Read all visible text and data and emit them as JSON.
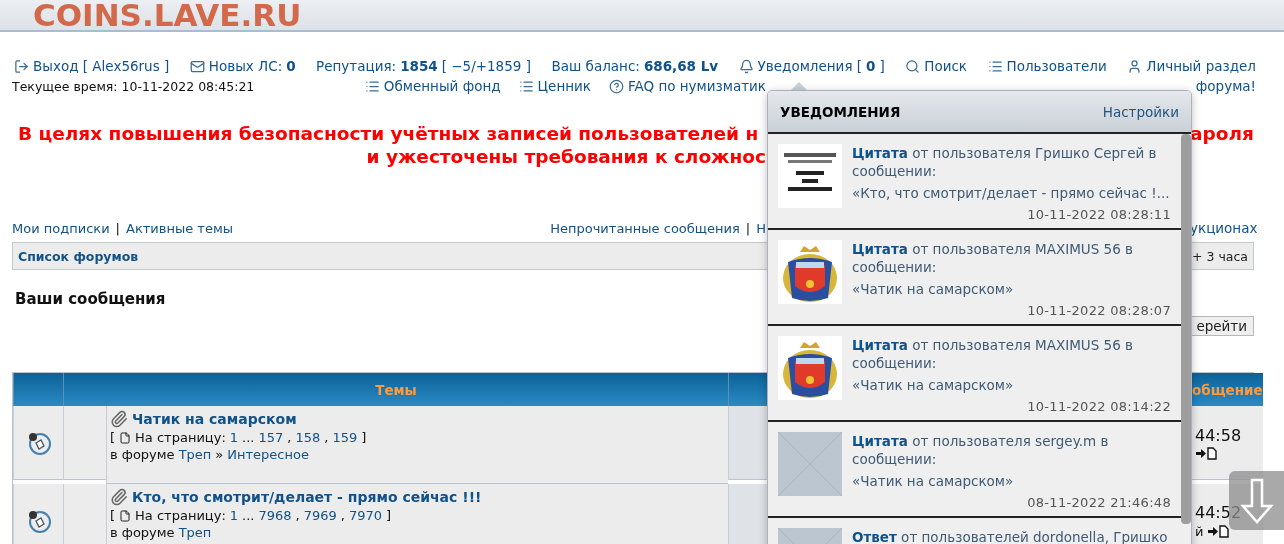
{
  "site_logo": "COINS.LAVE.RU",
  "user_bar": [
    {
      "text": "Выход [ Alex56rus ]"
    },
    {
      "text": "Новых ЛС: **0**"
    },
    {
      "text": "Репутация: **1854** [ −5/+1859 ]"
    },
    {
      "text": "Ваш баланс: **686,68 Lv**"
    },
    {
      "text": "Уведомления [**0**]"
    },
    {
      "text": "Поиск"
    },
    {
      "text": "Пользователи"
    },
    {
      "text": "Личный раздел"
    }
  ],
  "current_time": "Текущее время: 10-11-2022 08:45:21",
  "quick_links": [
    {
      "text": "Обменный фонд"
    },
    {
      "text": "Ценник"
    },
    {
      "text": "FAQ по нумизматик"
    }
  ],
  "quick_links_right": "форума!",
  "notice": {
    "line1_left": "В целях повышения безопасности учётных записей пользователей н",
    "line1_right": "ароля",
    "line2_left": "и ужесточены требования к сложнос"
  },
  "left_links": [
    {
      "text": "Мои подписки",
      "kind": "link"
    },
    {
      "text": "|",
      "kind": "sep"
    },
    {
      "text": "Активные темы",
      "kind": "link"
    }
  ],
  "middle_links": [
    {
      "text": "Непрочитанные сообщения",
      "kind": "link"
    },
    {
      "text": "|",
      "kind": "sep"
    },
    {
      "text": "Н",
      "kind": "link"
    }
  ],
  "right_link": "укционах",
  "nav_bar": {
    "title": "Список форумов",
    "timezone": "+ 3 часа"
  },
  "page_title": "Ваши сообщения",
  "go_button": "ерейти",
  "table": {
    "columns": [
      {
        "label": "Темы"
      },
      {
        "label": "общение"
      }
    ],
    "rows": [
      {
        "title": "Чатик на самарском",
        "pages_open": "[",
        "pages_label": "На страницу:",
        "pages": [
          {
            "text": "1",
            "kind": "link"
          },
          {
            "text": "...",
            "kind": "text"
          },
          {
            "text": "157",
            "kind": "link"
          },
          {
            "text": ",",
            "kind": "text"
          },
          {
            "text": "158",
            "kind": "link"
          },
          {
            "text": ",",
            "kind": "text"
          },
          {
            "text": "159",
            "kind": "link"
          }
        ],
        "pages_close": "]",
        "forum_label": "в форуме",
        "forum_path": [
          {
            "text": "Треп",
            "kind": "link"
          },
          {
            "text": "»",
            "kind": "text"
          },
          {
            "text": "Интересное",
            "kind": "link"
          }
        ],
        "last_time": "44:58"
      },
      {
        "title": "Кто, что смотрит/делает - прямо сейчас !!!",
        "pages_open": "[",
        "pages_label": "На страницу:",
        "pages": [
          {
            "text": "1",
            "kind": "link"
          },
          {
            "text": "...",
            "kind": "text"
          },
          {
            "text": "7968",
            "kind": "link"
          },
          {
            "text": ",",
            "kind": "text"
          },
          {
            "text": "7969",
            "kind": "link"
          },
          {
            "text": ",",
            "kind": "text"
          },
          {
            "text": "7970",
            "kind": "link"
          }
        ],
        "pages_close": "]",
        "forum_label": "в форуме",
        "forum_path": [
          {
            "text": "Треп",
            "kind": "link"
          }
        ],
        "last_time": "44:52",
        "last_author": "й"
      }
    ]
  },
  "notifications": {
    "title": "УВЕДОМЛЕНИЯ",
    "settings": "Настройки",
    "items": [
      {
        "kind": "logo",
        "text": "**Цитата** от пользователя Гришко Сергей в сообщении:",
        "quote": "«Кто, что смотрит/делает - прямо сейчас !...",
        "time": "10-11-2022 08:28:11"
      },
      {
        "kind": "crest",
        "text": "**Цитата** от пользователя MAXIMUS 56 в сообщении:",
        "quote": "«Чатик на самарском»",
        "time": "10-11-2022 08:28:07"
      },
      {
        "kind": "crest",
        "text": "**Цитата** от пользователя MAXIMUS 56 в сообщении:",
        "quote": "«Чатик на самарском»",
        "time": "10-11-2022 08:14:22"
      },
      {
        "kind": "blank",
        "text": "**Цитата** от пользователя sergey.m в сообщении:",
        "quote": "«Чатик на самарском»",
        "time": "08-11-2022 21:46:48"
      },
      {
        "kind": "blank",
        "text": "**Ответ** от пользователей dordonella, Гришко"
      }
    ]
  }
}
